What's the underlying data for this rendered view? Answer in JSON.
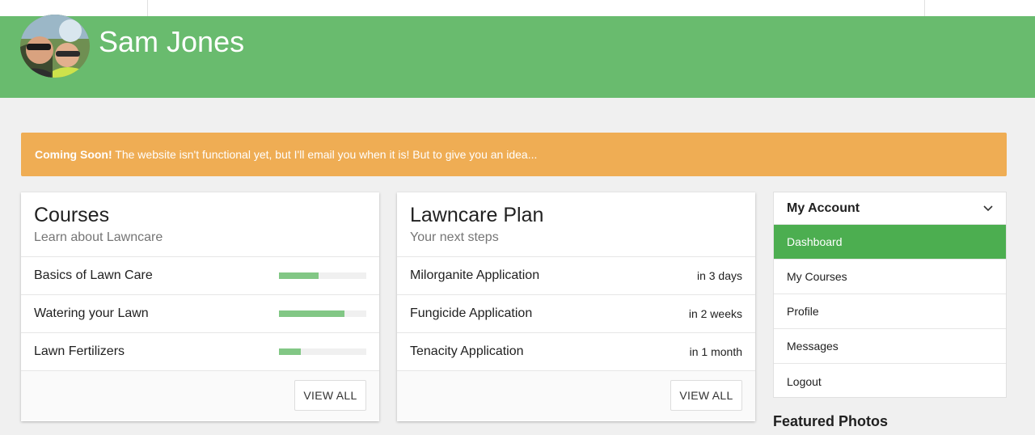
{
  "user": {
    "name": "Sam Jones"
  },
  "alert": {
    "strong": "Coming Soon!",
    "text": " The website isn't functional yet, but I'll email you when it is! But to give you an idea..."
  },
  "courses": {
    "title": "Courses",
    "subtitle": "Learn about Lawncare",
    "items": [
      {
        "label": "Basics of Lawn Care",
        "progress": 0.45
      },
      {
        "label": "Watering your Lawn",
        "progress": 0.75
      },
      {
        "label": "Lawn Fertilizers",
        "progress": 0.25
      }
    ],
    "button": "VIEW ALL"
  },
  "plan": {
    "title": "Lawncare Plan",
    "subtitle": "Your next steps",
    "items": [
      {
        "label": "Milorganite Application",
        "when": "in 3 days"
      },
      {
        "label": "Fungicide Application",
        "when": "in 2 weeks"
      },
      {
        "label": "Tenacity Application",
        "when": "in 1 month"
      }
    ],
    "button": "VIEW ALL"
  },
  "account": {
    "title": "My Account",
    "items": [
      "Dashboard",
      "My Courses",
      "Profile",
      "Messages",
      "Logout"
    ],
    "active_index": 0
  },
  "featured": {
    "title": "Featured Photos"
  },
  "colors": {
    "brand": "#69bb6e",
    "active": "#4cae50",
    "alert": "#efad54",
    "progress": "#82c785"
  },
  "icons": {
    "account_toggle": "chevron-down-icon"
  }
}
